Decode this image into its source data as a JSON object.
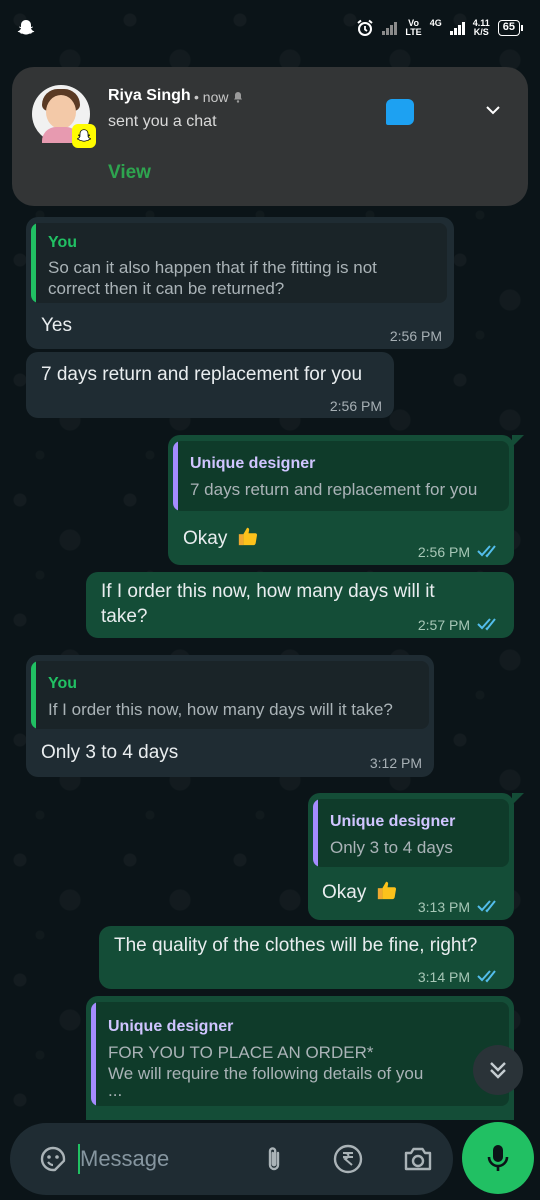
{
  "status_bar": {
    "volte": [
      "Vo",
      "LTE"
    ],
    "network": "4G",
    "speed": [
      "4.11",
      "K/S"
    ],
    "battery": "65"
  },
  "notification": {
    "sender": "Riya Singh",
    "time": "• now",
    "text": "sent you a chat",
    "action": "View",
    "icon_color": "#1da1f2"
  },
  "messages": [
    {
      "direction": "in",
      "quote_author": "You",
      "quote_lines": [
        "So can it also happen that if the fitting is not",
        "correct then it can be returned?"
      ],
      "text": "Yes",
      "time": "2:56 PM"
    },
    {
      "direction": "in",
      "text": "7 days return and replacement for you",
      "time": "2:56 PM"
    },
    {
      "direction": "out",
      "quote_author": "Unique designer",
      "quote_lines": [
        "7 days return and replacement for you"
      ],
      "text": "Okay",
      "emoji": "thumbs-up",
      "time": "2:56 PM"
    },
    {
      "direction": "out",
      "text_lines": [
        "If I order this now, how many days will it",
        "take?"
      ],
      "time": "2:57 PM"
    },
    {
      "direction": "in",
      "quote_author": "You",
      "quote_lines": [
        "If I order this now, how many days will it take?"
      ],
      "text": "Only 3 to 4 days",
      "time": "3:12 PM"
    },
    {
      "direction": "out",
      "quote_author": "Unique designer",
      "quote_lines": [
        "Only 3 to 4 days"
      ],
      "text": "Okay",
      "emoji": "thumbs-up",
      "time": "3:13 PM"
    },
    {
      "direction": "out",
      "text": "The quality of the clothes will be fine, right?",
      "time": "3:14 PM"
    },
    {
      "direction": "out",
      "quote_author": "Unique designer",
      "quote_lines": [
        "FOR YOU TO PLACE AN ORDER*",
        "We will require the following details of you",
        "..."
      ]
    }
  ],
  "input": {
    "placeholder": "Message"
  },
  "colors": {
    "accent": "#21c063",
    "incoming_bubble": "#1f2c33",
    "outgoing_bubble": "#144d37",
    "read_ticks": "#53bdeb"
  }
}
